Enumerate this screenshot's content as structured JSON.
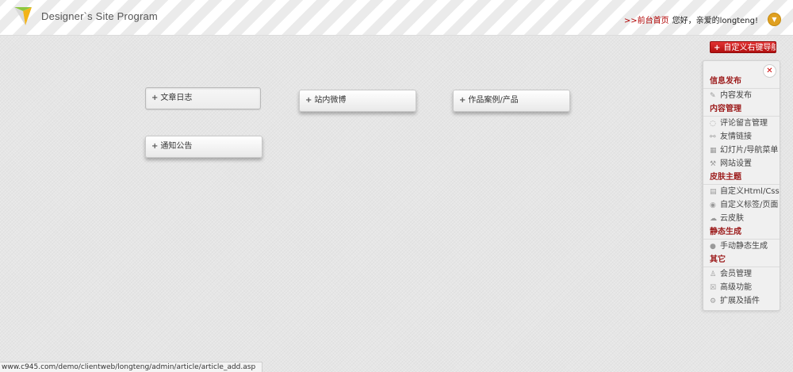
{
  "header": {
    "site_title": "Designer`s Site Program",
    "front_link": ">>前台首页",
    "greeting": "您好，亲爱的longteng!",
    "user_menu_icon": "chevron-down-icon"
  },
  "custom_nav_button": {
    "label": "自定义右键导航",
    "icon": "plus-icon"
  },
  "tiles": [
    {
      "label": "文章日志"
    },
    {
      "label": "站内微博"
    },
    {
      "label": "作品案例/产品"
    },
    {
      "label": "通知公告"
    }
  ],
  "panel": {
    "close_icon": "close-icon",
    "sections": [
      {
        "title": "信息发布",
        "items": [
          {
            "label": "内容发布",
            "icon": "pencil-icon"
          }
        ]
      },
      {
        "title": "内容管理",
        "items": [
          {
            "label": "评论留言管理",
            "icon": "comment-icon"
          },
          {
            "label": "友情链接",
            "icon": "link-icon"
          },
          {
            "label": "幻灯片/导航菜单",
            "icon": "slides-icon"
          },
          {
            "label": "网站设置",
            "icon": "wrench-icon"
          }
        ]
      },
      {
        "title": "皮肤主题",
        "items": [
          {
            "label": "自定义Html/Css",
            "icon": "code-icon"
          },
          {
            "label": "自定义标签/页面",
            "icon": "tag-icon"
          },
          {
            "label": "云皮肤",
            "icon": "cloud-icon"
          }
        ]
      },
      {
        "title": "静态生成",
        "items": [
          {
            "label": "手动静态生成",
            "icon": "user-icon"
          }
        ]
      },
      {
        "title": "其它",
        "items": [
          {
            "label": "会员管理",
            "icon": "member-icon"
          },
          {
            "label": "高级功能",
            "icon": "star-icon"
          },
          {
            "label": "扩展及插件",
            "icon": "plugin-icon"
          }
        ]
      }
    ]
  },
  "status_bar": {
    "url": "www.c945.com/demo/clientweb/longteng/admin/article/article_add.asp"
  }
}
